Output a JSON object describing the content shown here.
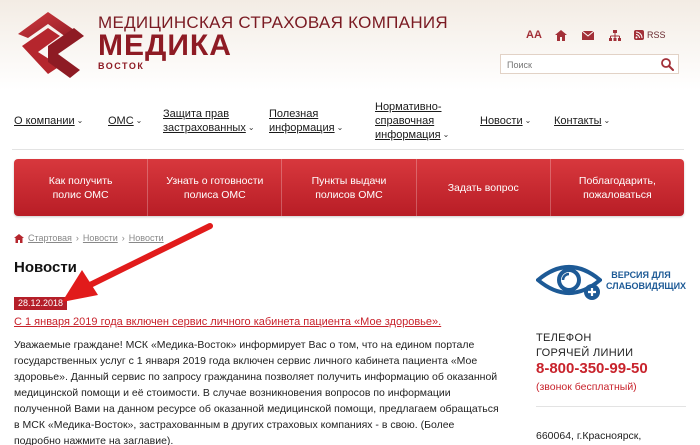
{
  "header": {
    "brand_top": "МЕДИЦИНСКАЯ СТРАХОВАЯ КОМПАНИЯ",
    "brand_name": "МЕДИКА",
    "brand_sub": "ВОСТОК",
    "font_size_label": "AA",
    "rss_label": "RSS",
    "search_placeholder": "Поиск"
  },
  "nav": {
    "items": [
      {
        "label": "О компании"
      },
      {
        "label": "ОМС"
      },
      {
        "label_line1": "Защита прав",
        "label_line2": "застрахованных"
      },
      {
        "label_line1": "Полезная",
        "label_line2": "информация"
      },
      {
        "label_line1": "Нормативно-",
        "label_line2": "справочная",
        "label_line3": "информация"
      },
      {
        "label": "Новости"
      },
      {
        "label": "Контакты"
      }
    ]
  },
  "actions": [
    {
      "line1": "Как получить",
      "line2": "полис ОМС"
    },
    {
      "line1": "Узнать о готовности",
      "line2": "полиса ОМС"
    },
    {
      "line1": "Пункты выдачи",
      "line2": "полисов ОМС"
    },
    {
      "line1": "Задать вопрос",
      "line2": ""
    },
    {
      "line1": "Поблагодарить,",
      "line2": "пожаловаться"
    }
  ],
  "breadcrumb": [
    "Стартовая",
    "Новости",
    "Новости"
  ],
  "page_title": "Новости",
  "news": {
    "date": "28.12.2018",
    "title": "С 1 января 2019 года включен сервис личного кабинета пациента «Мое здоровье».",
    "body": "Уважаемые граждане! МСК «Медика-Восток» информирует Вас о том, что на едином портале государственных услуг с 1 января 2019 года включен сервис личного кабинета пациента «Мое здоровье». Данный сервис по запросу гражданина позволяет получить информацию об оказанной медицинской помощи и её стоимости. В случае возникновения вопросов по информации полученной Вами на данном ресурсе об оказанной медицинской помощи, предлагаем обращаться в МСК «Медика-Восток», застрахованным в других страховых компаниях - в свою. (Более подробно нажмите на заглавие)."
  },
  "sidebar": {
    "vision_line1": "ВЕРСИЯ ДЛЯ",
    "vision_line2": "СЛАБОВИДЯЩИХ",
    "phone_line1": "ТЕЛЕФОН",
    "phone_line2": "ГОРЯЧЕЙ ЛИНИИ",
    "phone_number": "8-800-350-99-50",
    "phone_note": "(звонок бесплатный)",
    "address": "660064, г.Красноярск,"
  },
  "colors": {
    "brand_red": "#b81d26",
    "link_red": "#c8232c",
    "vision_blue": "#1d5a96"
  }
}
